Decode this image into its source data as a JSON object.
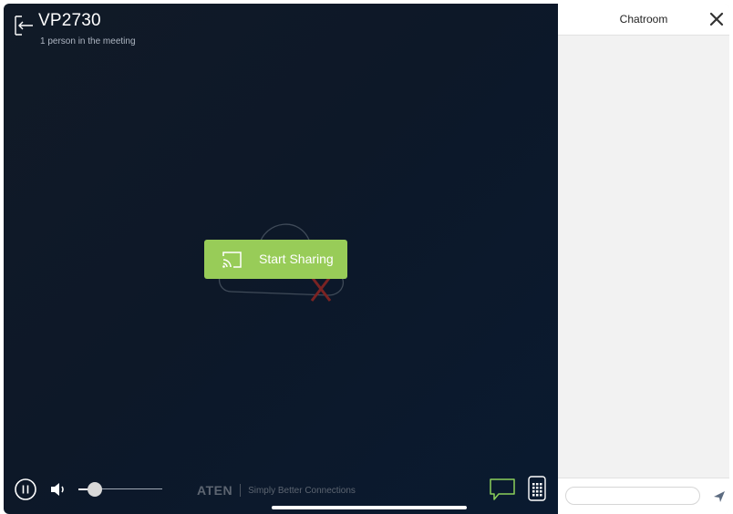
{
  "meeting": {
    "title": "VP2730",
    "participants_text": "1 person in the meeting"
  },
  "stage": {
    "start_sharing_label": "Start Sharing"
  },
  "controls": {
    "volume_level": 0.2
  },
  "brand": {
    "logo": "ATEN",
    "tagline": "Simply Better Connections"
  },
  "chat": {
    "title": "Chatroom",
    "input_value": "",
    "input_placeholder": ""
  },
  "icons": {
    "back": "exit-arrow-icon",
    "share": "cast-icon",
    "pause": "pause-icon",
    "volume": "speaker-icon",
    "chat": "chat-bubble-icon",
    "keypad": "keypad-icon",
    "close": "close-icon",
    "send": "send-icon"
  },
  "colors": {
    "share_button": "#98cc58",
    "chat_toggle": "#8bd05a",
    "background": "#0d1828",
    "chat_panel": "#f2f2f2"
  }
}
